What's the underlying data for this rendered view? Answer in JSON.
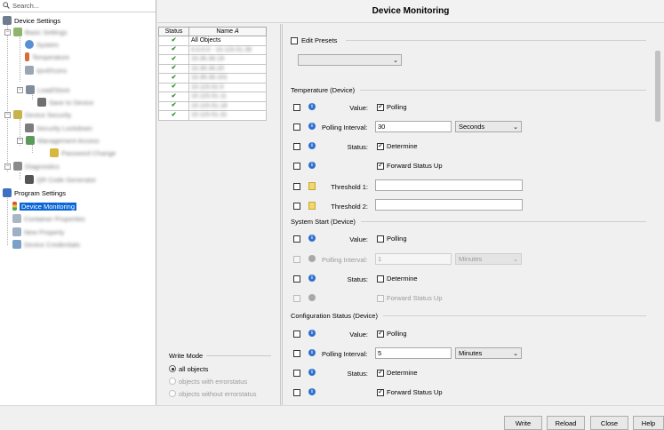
{
  "window": {
    "title": "Device Monitoring"
  },
  "search": {
    "placeholder": "Search..."
  },
  "tree": {
    "device_settings": "Device Settings",
    "basic_settings": "Basic Settings",
    "system": "System",
    "temperature": "Temperature",
    "ipv4": "Ipv4/Icons",
    "loadstore": "Load/Store",
    "save_to_device": "Save to Device",
    "device_security": "Device Security",
    "security_lockdown": "Security Lockdown",
    "management_access": "Management Access",
    "password_change": "Password Change",
    "diagnostics": "Diagnostics",
    "qr_code": "QR Code Generator",
    "program_settings": "Program Settings",
    "device_monitoring": "Device Monitoring",
    "container_properties": "Container Properties",
    "new_property": "New Property",
    "device_credentials": "Device Credentials"
  },
  "objects": {
    "col_status": "Status",
    "col_name": "Name",
    "sort_marker": "A",
    "rows": [
      {
        "name": "All Objects"
      },
      {
        "name": "0.0.0.0 - 10.115.51.39"
      },
      {
        "name": "10.30.30.19"
      },
      {
        "name": "10.30.30.20"
      },
      {
        "name": "10.30.30.101"
      },
      {
        "name": "10.115.51.5"
      },
      {
        "name": "10.115.51.11"
      },
      {
        "name": "10.115.51.18"
      },
      {
        "name": "10.115.51.31"
      }
    ]
  },
  "write_mode": {
    "title": "Write Mode",
    "options": [
      "all objects",
      "objects with errorstatus",
      "objects without errorstatus"
    ]
  },
  "settings": {
    "edit_presets": "Edit Presets",
    "temp_section": "Temperature (Device)",
    "sysstart_section": "System Start (Device)",
    "config_section": "Configuration Status (Device)",
    "value_label": "Value:",
    "polling_label": "Polling",
    "polling_interval_label": "Polling Interval:",
    "status_label": "Status:",
    "determine_label": "Determine",
    "forward_label": "Forward Status Up",
    "threshold1_label": "Threshold 1:",
    "threshold2_label": "Threshold 2:",
    "temp_interval": "30",
    "temp_unit": "Seconds",
    "sys_interval": "1",
    "sys_unit": "Minutes",
    "cfg_interval": "5",
    "cfg_unit": "Minutes"
  },
  "buttons": {
    "write": "Write",
    "reload": "Reload",
    "close": "Close",
    "help": "Help"
  }
}
